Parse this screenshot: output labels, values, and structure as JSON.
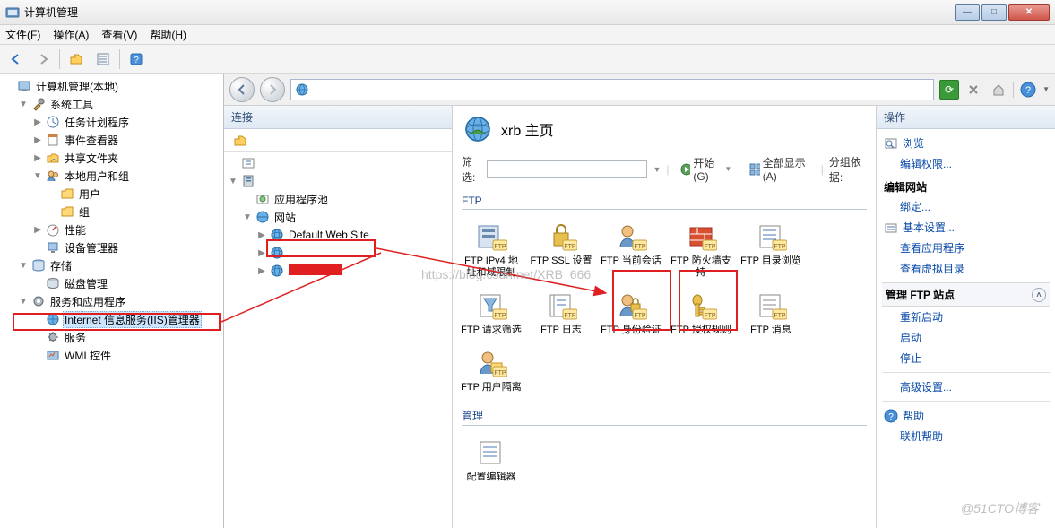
{
  "window": {
    "title": "计算机管理"
  },
  "menu": [
    "文件(F)",
    "操作(A)",
    "查看(V)",
    "帮助(H)"
  ],
  "mmc_tree": [
    {
      "label": "计算机管理(本地)",
      "depth": 0,
      "exp": "",
      "icon": "computer"
    },
    {
      "label": "系统工具",
      "depth": 1,
      "exp": "▼",
      "icon": "tools"
    },
    {
      "label": "任务计划程序",
      "depth": 2,
      "exp": "▶",
      "icon": "clock"
    },
    {
      "label": "事件查看器",
      "depth": 2,
      "exp": "▶",
      "icon": "event"
    },
    {
      "label": "共享文件夹",
      "depth": 2,
      "exp": "▶",
      "icon": "share"
    },
    {
      "label": "本地用户和组",
      "depth": 2,
      "exp": "▼",
      "icon": "users"
    },
    {
      "label": "用户",
      "depth": 3,
      "exp": "",
      "icon": "folder"
    },
    {
      "label": "组",
      "depth": 3,
      "exp": "",
      "icon": "folder"
    },
    {
      "label": "性能",
      "depth": 2,
      "exp": "▶",
      "icon": "perf"
    },
    {
      "label": "设备管理器",
      "depth": 2,
      "exp": "",
      "icon": "device"
    },
    {
      "label": "存储",
      "depth": 1,
      "exp": "▼",
      "icon": "storage"
    },
    {
      "label": "磁盘管理",
      "depth": 2,
      "exp": "",
      "icon": "disk"
    },
    {
      "label": "服务和应用程序",
      "depth": 1,
      "exp": "▼",
      "icon": "svc"
    },
    {
      "label": "Internet 信息服务(IIS)管理器",
      "depth": 2,
      "exp": "",
      "icon": "iis",
      "selected": true
    },
    {
      "label": "服务",
      "depth": 2,
      "exp": "",
      "icon": "gear"
    },
    {
      "label": "WMI 控件",
      "depth": 2,
      "exp": "",
      "icon": "wmi"
    }
  ],
  "iis": {
    "conn_header": "连接",
    "conn_tree": [
      {
        "label": "",
        "depth": 0,
        "exp": "",
        "icon": "start"
      },
      {
        "label": "",
        "depth": 0,
        "exp": "▼",
        "icon": "server",
        "redact": true
      },
      {
        "label": "应用程序池",
        "depth": 1,
        "exp": "",
        "icon": "apppool"
      },
      {
        "label": "网站",
        "depth": 1,
        "exp": "▼",
        "icon": "sites"
      },
      {
        "label": "Default Web Site",
        "depth": 2,
        "exp": "▶",
        "icon": "globe"
      },
      {
        "label": "",
        "depth": 2,
        "exp": "▶",
        "icon": "globe",
        "redact": true
      },
      {
        "label": "",
        "depth": 2,
        "exp": "▶",
        "icon": "globe",
        "redact_red": true
      }
    ],
    "page_title": "xrb 主页",
    "filter_label": "筛选:",
    "start_label": "开始(G)",
    "showall_label": "全部显示(A)",
    "groupby_label": "分组依据:",
    "group_ftp": "FTP",
    "group_mgmt": "管理",
    "features_ftp": [
      {
        "name": "ftp-ipv4",
        "label": "FTP IPv4 地址和域限制"
      },
      {
        "name": "ftp-ssl",
        "label": "FTP SSL 设置"
      },
      {
        "name": "ftp-sessions",
        "label": "FTP 当前会话"
      },
      {
        "name": "ftp-firewall",
        "label": "FTP 防火墙支持"
      },
      {
        "name": "ftp-browse",
        "label": "FTP 目录浏览"
      },
      {
        "name": "ftp-reqfilter",
        "label": "FTP 请求筛选"
      },
      {
        "name": "ftp-log",
        "label": "FTP 日志"
      },
      {
        "name": "ftp-auth",
        "label": "FTP 身份验证"
      },
      {
        "name": "ftp-authz",
        "label": "FTP 授权规则"
      },
      {
        "name": "ftp-messages",
        "label": "FTP 消息"
      },
      {
        "name": "ftp-isolation",
        "label": "FTP 用户隔离"
      }
    ],
    "features_mgmt": [
      {
        "name": "config-editor",
        "label": "配置编辑器"
      }
    ],
    "actions_header": "操作",
    "actions": {
      "browse": "浏览",
      "edit_perm": "编辑权限...",
      "edit_site_hdr": "编辑网站",
      "bindings": "绑定...",
      "basic": "基本设置...",
      "view_apps": "查看应用程序",
      "view_vdirs": "查看虚拟目录",
      "manage_hdr": "管理 FTP 站点",
      "restart": "重新启动",
      "start": "启动",
      "stop": "停止",
      "adv": "高级设置...",
      "help": "帮助",
      "online_help": "联机帮助"
    }
  },
  "watermarks": {
    "csdn": "https://blog.csdn.net/XRB_666",
    "cto": "@51CTO博客"
  }
}
